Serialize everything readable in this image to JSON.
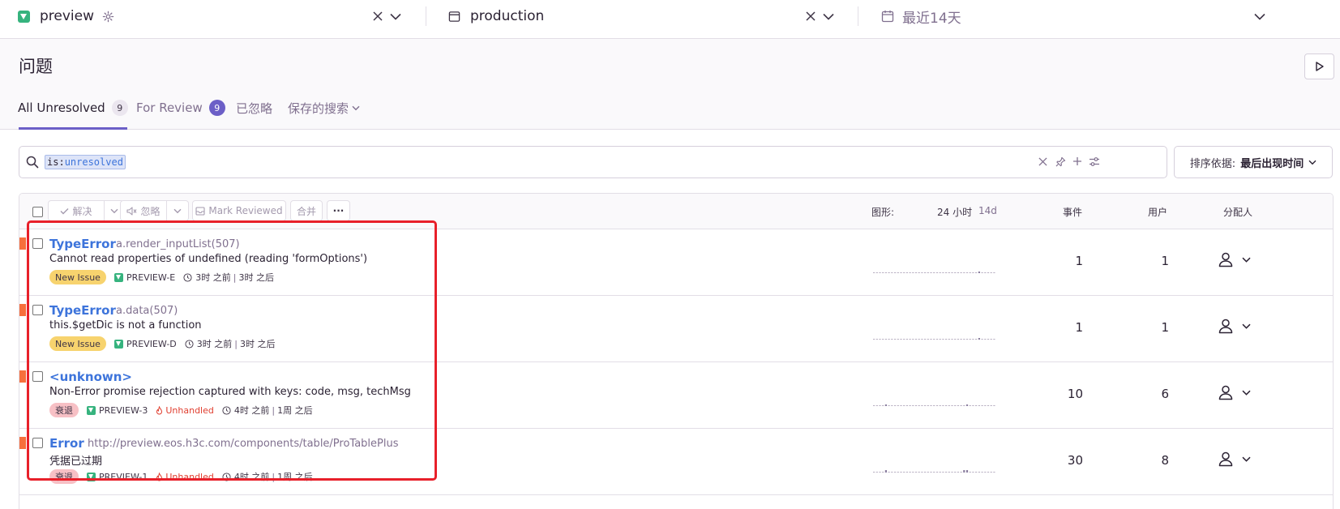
{
  "topbar": {
    "project": "preview",
    "environment": "production",
    "date_range": "最近14天"
  },
  "page": {
    "title": "问题"
  },
  "tabs": [
    {
      "label": "All Unresolved",
      "count": "9"
    },
    {
      "label": "For Review",
      "count": "9"
    },
    {
      "label": "已忽略"
    },
    {
      "label": "保存的搜索"
    }
  ],
  "search": {
    "token_key": "is:",
    "token_value": "unresolved"
  },
  "sort": {
    "label": "排序依据:",
    "value": "最后出现时间"
  },
  "toolbar": {
    "resolve": "解决",
    "ignore": "忽略",
    "mark_reviewed": "Mark Reviewed",
    "merge": "合并",
    "more": "···"
  },
  "columns": {
    "graph": "图形:",
    "period_24h": "24 小时",
    "period_14d": "14d",
    "events": "事件",
    "users": "用户",
    "assignee": "分配人"
  },
  "issues": [
    {
      "type": "TypeError",
      "culprit": "a.render_inputList(507)",
      "message": "Cannot read properties of undefined (reading 'formOptions')",
      "badge": "New Issue",
      "short_id": "PREVIEW-E",
      "unhandled": "",
      "age": "3时 之前",
      "last_seen": "3时 之后",
      "events": "1",
      "users": "1"
    },
    {
      "type": "TypeError",
      "culprit": "a.data(507)",
      "message": "this.$getDic is not a function",
      "badge": "New Issue",
      "short_id": "PREVIEW-D",
      "unhandled": "",
      "age": "3时 之前",
      "last_seen": "3时 之后",
      "events": "1",
      "users": "1"
    },
    {
      "type": "<unknown>",
      "culprit": "",
      "message": "Non-Error promise rejection captured with keys: code, msg, techMsg",
      "badge": "衰退",
      "short_id": "PREVIEW-3",
      "unhandled": "Unhandled",
      "age": "4时 之前",
      "last_seen": "1周 之后",
      "events": "10",
      "users": "6"
    },
    {
      "type": "Error",
      "culprit": "http://preview.eos.h3c.com/components/table/ProTablePlus",
      "message": "凭据已过期",
      "badge": "衰退",
      "short_id": "PREVIEW-1",
      "unhandled": "Unhandled",
      "age": "4时 之前",
      "last_seen": "1周 之后",
      "events": "30",
      "users": "8"
    }
  ],
  "colors": {
    "accent": "#6c5fc7",
    "link": "#3d74db",
    "error_level": "#f76f3c",
    "new_issue": "#f7d36e",
    "regression": "#f7c0c5",
    "unhandled": "#e03e2f",
    "highlight": "#e8202a"
  }
}
